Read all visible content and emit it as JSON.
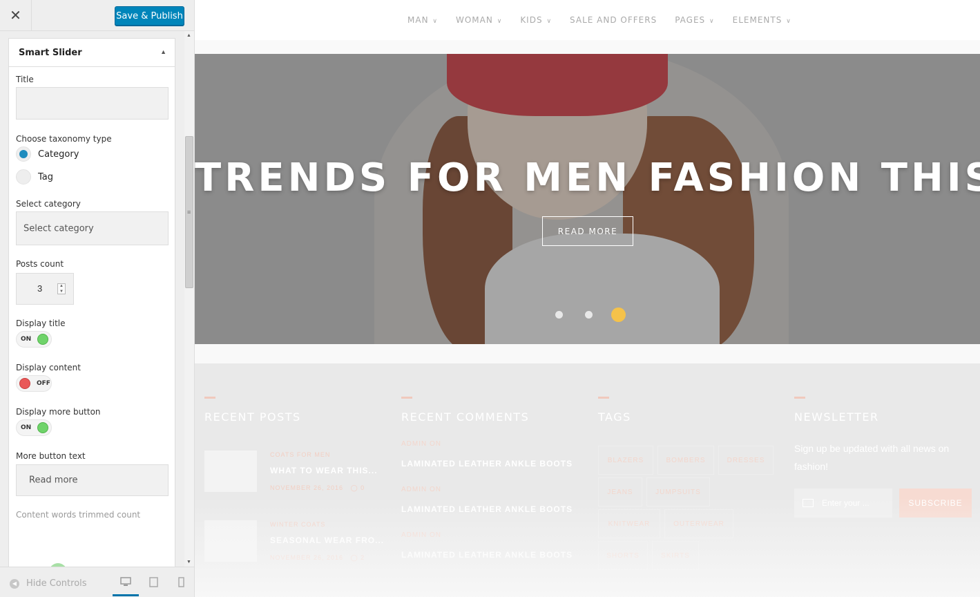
{
  "sidebar": {
    "close_icon": "close-icon",
    "save_label": "Save & Publish",
    "section_title": "Smart Slider",
    "fields": {
      "title_label": "Title",
      "title_value": "",
      "taxonomy_label": "Choose taxonomy type",
      "taxonomy_options": [
        "Category",
        "Tag"
      ],
      "taxonomy_selected": "Category",
      "category_label": "Select category",
      "category_value": "Select category",
      "posts_count_label": "Posts count",
      "posts_count": "3",
      "display_title_label": "Display title",
      "display_title_state": "ON",
      "display_content_label": "Display content",
      "display_content_state": "OFF",
      "display_more_label": "Display more button",
      "display_more_state": "ON",
      "more_text_label": "More button text",
      "more_text_value": "Read more",
      "trim_label": "Content words trimmed count"
    },
    "footer": {
      "hide_controls": "Hide Controls",
      "devices": [
        "desktop",
        "tablet",
        "mobile"
      ],
      "active_device": "desktop"
    },
    "accent_color": "#0085ba"
  },
  "preview": {
    "nav": [
      "MAN",
      "WOMAN",
      "KIDS",
      "SALE AND OFFERS",
      "PAGES",
      "ELEMENTS"
    ],
    "nav_has_dropdown": [
      true,
      true,
      true,
      false,
      true,
      true
    ],
    "hero": {
      "title": "TRENDS FOR MEN FASHION THIS FALL",
      "button": "READ MORE",
      "slides": 3,
      "active_slide": 3,
      "active_dot_color": "#f5c24a"
    },
    "widgets": {
      "recent_posts": {
        "title": "RECENT POSTS",
        "posts": [
          {
            "category": "COATS FOR MEN",
            "title": "WHAT TO WEAR THIS...",
            "date": "NOVEMBER 26, 2016",
            "comments": "0"
          },
          {
            "category": "WINTER COATS",
            "title": "SEASONAL WEAR FRO...",
            "date": "NOVEMBER 26, 2016",
            "comments": "2"
          }
        ]
      },
      "recent_comments": {
        "title": "RECENT COMMENTS",
        "comments": [
          {
            "author": "ADMIN ON",
            "post": "LAMINATED LEATHER ANKLE BOOTS"
          },
          {
            "author": "ADMIN ON",
            "post": "LAMINATED LEATHER ANKLE BOOTS"
          },
          {
            "author": "ADMIN ON",
            "post": "LAMINATED LEATHER ANKLE BOOTS"
          }
        ]
      },
      "tags": {
        "title": "TAGS",
        "items": [
          "BLAZERS",
          "BOMBERS",
          "DRESSES",
          "JEANS",
          "JUMPSUITS",
          "KNITWEAR",
          "OUTERWEAR",
          "SHORTS",
          "SKIRTS"
        ]
      },
      "newsletter": {
        "title": "NEWSLETTER",
        "text": "Sign up be updated with all news on fashion!",
        "placeholder": "Enter your ...",
        "button": "SUBSCRIBE"
      }
    }
  }
}
